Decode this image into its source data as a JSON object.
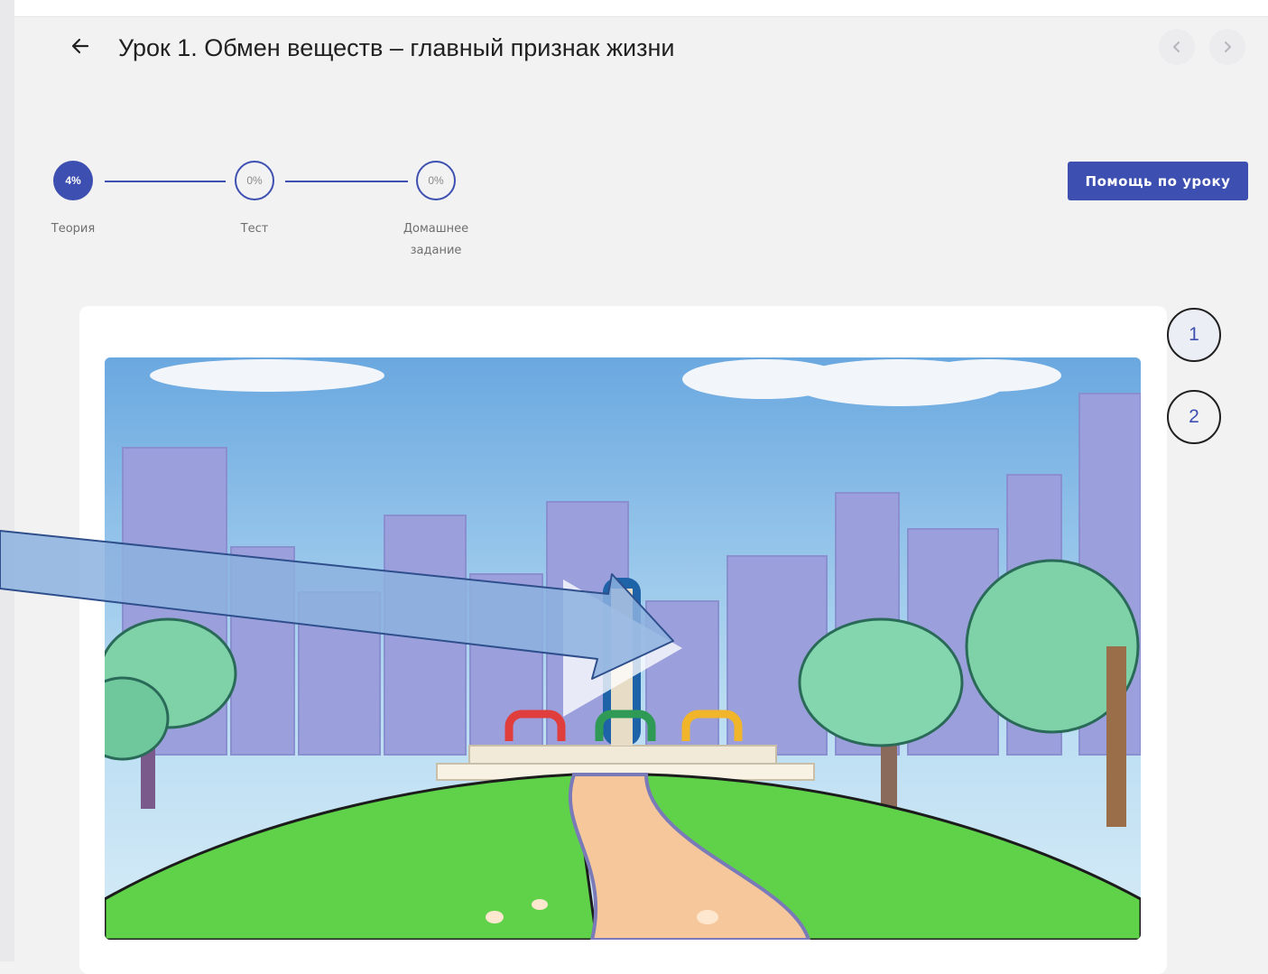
{
  "header": {
    "title": "Урок 1. Обмен веществ – главный признак жизни",
    "back_icon": "arrow-left-icon",
    "prev_icon": "chevron-left-icon",
    "next_icon": "chevron-right-icon"
  },
  "stepper": {
    "steps": [
      {
        "percent": "4%",
        "label": "Теория",
        "active": true
      },
      {
        "percent": "0%",
        "label": "Тест",
        "active": false
      },
      {
        "percent": "0%",
        "label": "Домашнее",
        "label2": "задание",
        "active": false
      }
    ]
  },
  "help_button": {
    "label": "Помощь по уроку"
  },
  "slides": [
    {
      "number": "1"
    },
    {
      "number": "2"
    }
  ],
  "video": {
    "play_icon": "play-icon"
  },
  "colors": {
    "accent": "#3d4fb0",
    "background": "#f2f2f2",
    "card": "#ffffff"
  }
}
